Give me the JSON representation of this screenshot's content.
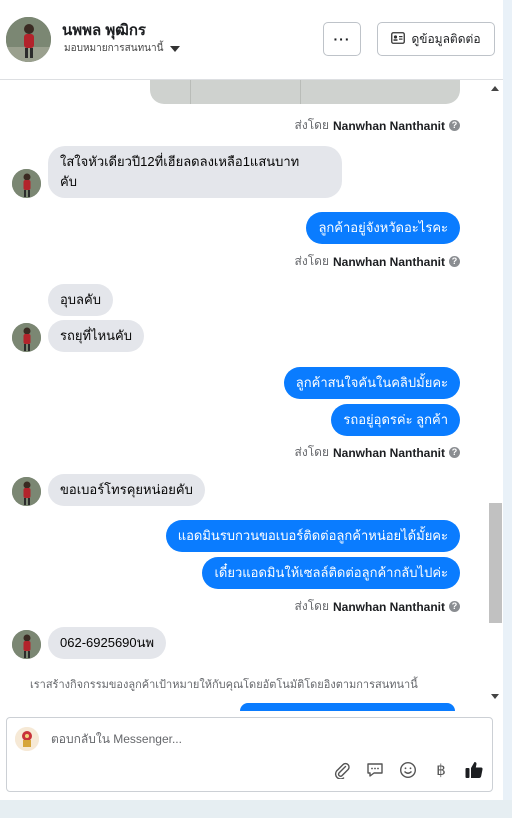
{
  "header": {
    "name": "นพพล พุฒิกร",
    "assign_label": "มอบหมายการสนทนานี้",
    "more_label": "···",
    "contact_button_label": "ดูข้อมูลติดต่อ"
  },
  "messages": {
    "sent_by_prefix": "ส่งโดย",
    "agent_name": "Nanwhan Nanthanit",
    "in_1": "ใสใจหัวเดียวปี12ที่เฮียลดลงเหลือ1แสนบาท\nคับ",
    "out_1": "ลูกค้าอยู่จังหวัดอะไรคะ",
    "in_2": "อุบลคับ",
    "in_3": "รถยุที่ไหนคับ",
    "out_2": "ลูกค้าสนใจคันในคลิปมั้ยคะ",
    "out_3": "รถอยู่อุดรค่ะ ลูกค้า",
    "in_4": "ขอเบอร์โทรคุยหน่อยคับ",
    "out_4": "แอดมินรบกวนขอเบอร์ติดต่อลูกค้าหน่อยได้มั้ยคะ",
    "out_5": "เดี๋ยวแอดมินให้เซลล์ติดต่อลูกค้ากลับไปค่ะ",
    "in_5": "062-6925690นพ"
  },
  "system_note": "เราสร้างกิจกรรมของลูกค้าเป้าหมายให้กับคุณโดยอัตโนมัติโดยอิงตามการสนทนานี้",
  "composer": {
    "placeholder": "ตอบกลับใน Messenger...",
    "icons": [
      "paperclip-icon",
      "saved-reply-icon",
      "emoji-icon",
      "baht-icon",
      "thumbs-up-icon"
    ]
  },
  "colors": {
    "outgoing_bubble": "#0a7cff",
    "incoming_bubble": "#e4e6eb"
  }
}
